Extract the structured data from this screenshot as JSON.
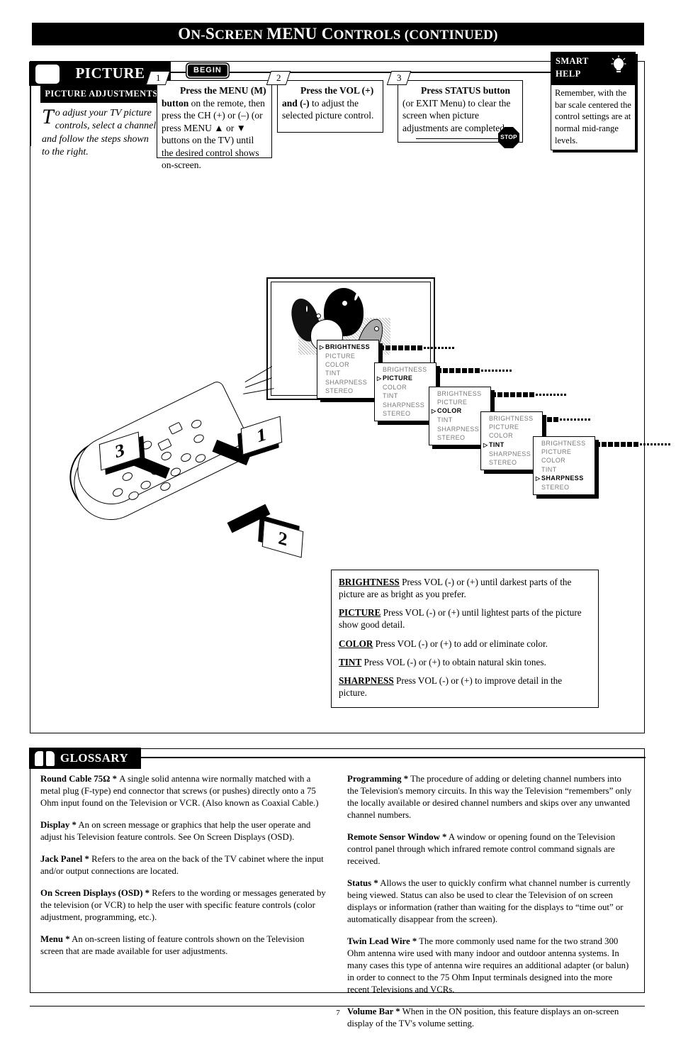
{
  "page": {
    "title": "ON-SCREEN MENU CONTROLS (CONTINUED)",
    "title_parts": {
      "on": "O",
      "on_rest": "N-",
      "screen_s": "S",
      "screen_rest": "CREEN ",
      "menu": "MENU ",
      "controls_c": "C",
      "controls_rest": "ONTROLS ",
      "continued": "(CONTINUED)"
    },
    "number": "7"
  },
  "picture_section": {
    "header_label": "PICTURE",
    "tv_icon": "tv-screen-icon",
    "begin_label": "BEGIN",
    "adjustments": {
      "heading": "PICTURE ADJUSTMENTS",
      "dropcap": "T",
      "body": "o adjust your TV picture controls, select a channel and follow the steps shown to the right."
    },
    "steps": [
      {
        "number": "1",
        "bold_lead": "Press the MENU (M) button",
        "rest": " on the remote, then press the CH (+) or (–) (or press MENU ▲ or ▼ buttons on the TV) until the desired control shows on-screen."
      },
      {
        "number": "2",
        "bold_lead": "Press the VOL (+) and (-)",
        "rest": " to adjust the selected picture control."
      },
      {
        "number": "3",
        "bold_lead": "Press STATUS button",
        "rest": " (or EXIT Menu) to clear the screen when picture adjustments are completed.",
        "stop_label": "STOP"
      }
    ],
    "smart_help": {
      "line1": "SMART",
      "line2": "HELP",
      "icon": "lightbulb-icon",
      "body": "Remember, with the bar scale centered the control settings are at normal mid-range levels."
    }
  },
  "osd_menus": {
    "items": [
      "BRIGHTNESS",
      "PICTURE",
      "COLOR",
      "TINT",
      "SHARPNESS",
      "STEREO"
    ],
    "screens": [
      {
        "selected": "BRIGHTNESS"
      },
      {
        "selected": "PICTURE"
      },
      {
        "selected": "COLOR"
      },
      {
        "selected": "TINT"
      },
      {
        "selected": "SHARPNESS"
      }
    ]
  },
  "remote_callouts": [
    "1",
    "2",
    "3"
  ],
  "control_definitions": [
    {
      "term": "BRIGHTNESS",
      "text": " Press VOL (-) or (+) until darkest parts of the picture are as bright as you prefer."
    },
    {
      "term": "PICTURE",
      "text": " Press VOL (-) or (+) until lightest parts of the picture show good detail."
    },
    {
      "term": "COLOR",
      "text": " Press VOL (-) or (+) to add or eliminate color."
    },
    {
      "term": "TINT",
      "text": " Press VOL (-) or (+) to obtain natural skin tones."
    },
    {
      "term": "SHARPNESS",
      "text": " Press VOL (-) or (+) to improve detail in the picture."
    }
  ],
  "glossary": {
    "heading": "GLOSSARY",
    "icon": "open-book-icon",
    "left_column": [
      {
        "term": "Round Cable 75Ω *",
        "text": " A single solid antenna wire normally matched with a metal plug (F-type) end connector that screws (or pushes) directly onto a 75 Ohm input found on the Television or VCR. (Also known as Coaxial Cable.)"
      },
      {
        "term": "Display *",
        "text": " An on screen message or graphics that help the user operate and adjust his Television feature controls. See On Screen Displays (OSD)."
      },
      {
        "term": "Jack Panel *",
        "text": " Refers to the area on the back of the TV cabinet where the input and/or output connections are located."
      },
      {
        "term": "On Screen Displays (OSD) *",
        "text": " Refers to the wording or messages generated by the television (or VCR) to help the user with specific feature controls (color adjustment, programming, etc.)."
      },
      {
        "term": "Menu *",
        "text": " An on-screen listing of feature controls shown on the Television screen that are made available for user adjustments."
      }
    ],
    "right_column": [
      {
        "term": "Programming *",
        "text": " The procedure of adding or deleting channel numbers into the Television's memory circuits. In this way the Television “remembers” only the locally available or desired channel numbers and skips over any unwanted channel numbers."
      },
      {
        "term": "Remote Sensor Window *",
        "text": " A window or opening found on the Television control panel through which infrared remote control command signals are received."
      },
      {
        "term": "Status *",
        "text": " Allows the user to quickly confirm what channel number is currently being viewed. Status can also be used to clear the Television of on screen displays or information (rather than waiting for the displays to “time out” or automatically disappear from the screen)."
      },
      {
        "term": "Twin Lead Wire *",
        "text": " The more commonly used name for the two strand 300 Ohm antenna wire used with many indoor and outdoor antenna systems. In many cases this type of antenna wire requires an additional adapter (or balun) in order to connect to the 75 Ohm Input terminals designed into the more recent Televisions and VCRs."
      },
      {
        "term": "Volume Bar *",
        "text": "  When in the ON position, this feature displays an on-screen display of the TV's volume setting."
      }
    ]
  }
}
